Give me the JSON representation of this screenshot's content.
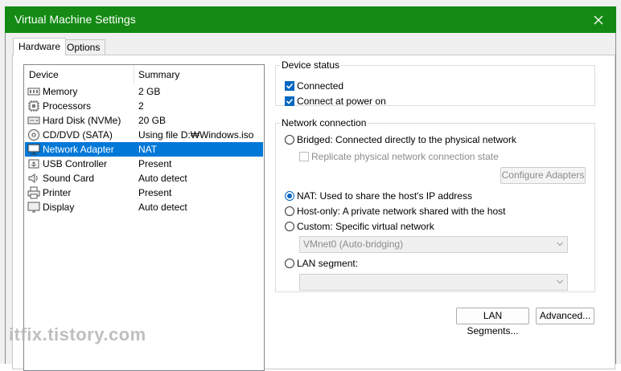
{
  "window": {
    "title": "Virtual Machine Settings"
  },
  "tabs": [
    {
      "label": "Hardware",
      "active": true
    },
    {
      "label": "Options",
      "active": false
    }
  ],
  "device_list": {
    "columns": {
      "device": "Device",
      "summary": "Summary"
    },
    "items": [
      {
        "icon": "memory-icon",
        "name": "Memory",
        "summary": "2 GB",
        "selected": false
      },
      {
        "icon": "processor-icon",
        "name": "Processors",
        "summary": "2",
        "selected": false
      },
      {
        "icon": "hard-disk-icon",
        "name": "Hard Disk (NVMe)",
        "summary": "20 GB",
        "selected": false
      },
      {
        "icon": "cd-dvd-icon",
        "name": "CD/DVD (SATA)",
        "summary": "Using file D:₩Windows.iso",
        "selected": false
      },
      {
        "icon": "network-adapter-icon",
        "name": "Network Adapter",
        "summary": "NAT",
        "selected": true
      },
      {
        "icon": "usb-controller-icon",
        "name": "USB Controller",
        "summary": "Present",
        "selected": false
      },
      {
        "icon": "sound-card-icon",
        "name": "Sound Card",
        "summary": "Auto detect",
        "selected": false
      },
      {
        "icon": "printer-icon",
        "name": "Printer",
        "summary": "Present",
        "selected": false
      },
      {
        "icon": "display-icon",
        "name": "Display",
        "summary": "Auto detect",
        "selected": false
      }
    ]
  },
  "device_status": {
    "legend": "Device status",
    "connected": {
      "label": "Connected",
      "checked": true
    },
    "connect_at_power_on": {
      "label": "Connect at power on",
      "checked": true
    }
  },
  "network_connection": {
    "legend": "Network connection",
    "bridged": {
      "label": "Bridged: Connected directly to the physical network",
      "checked": false
    },
    "replicate": {
      "label": "Replicate physical network connection state",
      "checked": false,
      "enabled": false
    },
    "configure_adapters": "Configure Adapters",
    "nat": {
      "label": "NAT: Used to share the host's IP address",
      "checked": true
    },
    "host_only": {
      "label": "Host-only: A private network shared with the host",
      "checked": false
    },
    "custom": {
      "label": "Custom: Specific virtual network",
      "checked": false
    },
    "custom_select": "VMnet0 (Auto-bridging)",
    "lan_segment": {
      "label": "LAN segment:",
      "checked": false
    },
    "lan_select": ""
  },
  "buttons": {
    "lan_segments": "LAN Segments...",
    "advanced": "Advanced..."
  },
  "watermark": "itfix.tistory.com",
  "colors": {
    "titlebar": "#148a14",
    "selection": "#0078d7",
    "checkbox": "#0067c0"
  }
}
